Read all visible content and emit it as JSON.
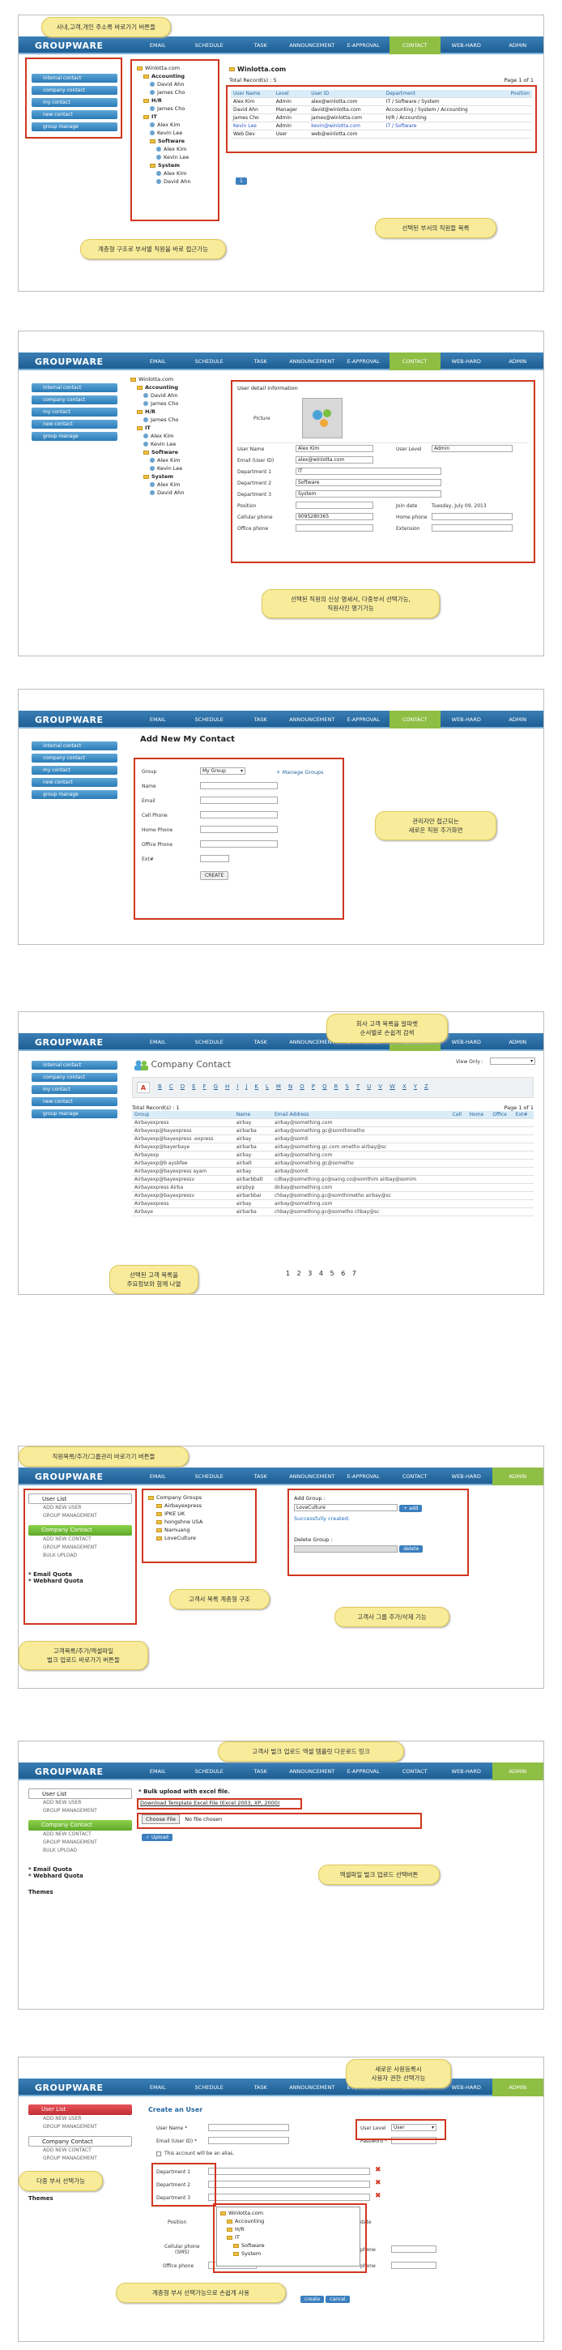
{
  "app": {
    "logo": "GROUPWARE",
    "nav": [
      "EMAIL",
      "SCHEDULE",
      "TASK",
      "ANNOUNCEMENT",
      "E-APPROVAL",
      "CONTACT",
      "WEB-HARD",
      "ADMIN"
    ],
    "nav_short": [
      "EMAIL",
      "SCHEDULE",
      "TASK",
      "ANNOUNCEMENT",
      "E-APPROVAL",
      "CONTACT",
      "WEB-HARD",
      "ADMIN"
    ]
  },
  "side": {
    "internal": "internal contact",
    "company": "company contact",
    "my": "my contact",
    "new": "new contact",
    "group": "group manage"
  },
  "tree": {
    "root": "Winlotta.com",
    "accounting": "Accounting",
    "david": "David Ahn",
    "james": "James Cho",
    "hr": "H/R",
    "it": "IT",
    "alex": "Alex Kim",
    "kevin": "Kevin Lee",
    "software": "Software",
    "system": "System"
  },
  "p1": {
    "note_top": "사내,고객,개인 주소록 바로가기 버튼들",
    "note_tree": "계층형 구조로 부서별 직원을 바로 접근가능",
    "note_list": "선택된 부서의 직원들 목록",
    "title": "Winlotta.com",
    "total": "Total Record(s) : 5",
    "page": "Page 1 of 1",
    "cols": [
      "User Name",
      "Level",
      "User ID",
      "Department",
      "Position"
    ],
    "rows": [
      [
        "Alex Kim",
        "Admin",
        "alex@winlotta.com",
        "IT / Software / System",
        ""
      ],
      [
        "David Ahn",
        "Manager",
        "david@winlotta.com",
        "Accounting / System / Accounting",
        ""
      ],
      [
        "James Cho",
        "Admin",
        "james@winlotta.com",
        "H/R / Accounting",
        ""
      ],
      [
        "Kevin Lee",
        "Admin",
        "kevin@winlotta.com",
        "IT / Software",
        ""
      ],
      [
        "Web Dev",
        "User",
        "web@winlotta.com",
        "",
        ""
      ]
    ],
    "pager": "1"
  },
  "p2": {
    "detail_title": "User detail information",
    "picture": "Picture",
    "user_name_l": "User Name",
    "user_name": "Alex Kim",
    "user_level_l": "User Level",
    "user_level": "Admin",
    "email_l": "Email (User ID)",
    "email": "alex@winlotta.com",
    "d1_l": "Department 1",
    "d1": "IT",
    "d2_l": "Department 2",
    "d2": "Software",
    "d3_l": "Department 3",
    "d3": "System",
    "pos_l": "Position",
    "join_l": "Join date",
    "join": "Tuesday, July 09, 2013",
    "cell_l": "Cellular phone",
    "cell": "9095280365",
    "home_l": "Home phone",
    "office_l": "Office phone",
    "ext_l": "Extension",
    "note": "선택된 직원의 신상 명세서, 다중부서 선택가능,\n직원사진 명기가능"
  },
  "p3": {
    "title": "Add New My Contact",
    "group_l": "Group",
    "group_v": "My Group",
    "manage": "+ Manage Groups",
    "fields": [
      "Name",
      "Email",
      "Cell Phone",
      "Home Phone",
      "Office Phone",
      "Ext#"
    ],
    "create": "CREATE",
    "note": "관리자만 접근되는\n새로운 직원 추가화면"
  },
  "p4": {
    "title": "Company Contact",
    "view_only": "View Only :",
    "letters": [
      "A",
      "B",
      "C",
      "D",
      "E",
      "F",
      "G",
      "H",
      "I",
      "J",
      "K",
      "L",
      "M",
      "N",
      "O",
      "P",
      "Q",
      "R",
      "S",
      "T",
      "U",
      "V",
      "W",
      "X",
      "Y",
      "Z"
    ],
    "total": "Total Record(s) : 1",
    "page": "Page 1 of 1",
    "cols": [
      "Group",
      "Name",
      "Email Address",
      "Cell",
      "Home",
      "Office",
      "Ext#"
    ],
    "rows": [
      [
        "Airbayexpress",
        "airbay",
        "airbay@something.com"
      ],
      [
        "Airbayexp@bayexpress",
        "airbarba",
        "airbay@something.gc@somthimetho"
      ],
      [
        "Airbayexp@bayexpress .express",
        "airbay",
        "airbay@somit"
      ],
      [
        "Airbayexp@bayerbaye",
        "airbarba",
        "airbay@something.gc.com ometho  airbay@sc"
      ],
      [
        "Airbayexp",
        "airbay",
        "airbay@something.com"
      ],
      [
        "Airbayexp@b  aysbfee",
        "airbalt",
        "airbay@something.gc@sometho"
      ],
      [
        "Airbayexp@bayexpress  ayam",
        "airbay",
        "airbay@somit"
      ],
      [
        "Airbayexp@bayexpressv",
        "airbarbbalt",
        "cdbay@something.gc@saing.co@somthim  airbay@somim"
      ],
      [
        "Airbayexpress  Airba",
        "airpbyp",
        "dnbay@something.com"
      ],
      [
        "Airbayexp@bayexpressv",
        "airbarbbai",
        "chbay@something.gc@somthimetho  airbay@sc"
      ],
      [
        "Airbayexpress",
        "airbay",
        "airbay@something.com"
      ],
      [
        "Airbaye",
        "airbarba",
        "chbay@something.gc@sometho  chbay@sc"
      ]
    ],
    "pager": "1 2 3 4 5 6 7",
    "note_top": "회사 고객 목록을 알파벳\n순서별로 손쉽게 검색",
    "note_bottom": "선택된 고객 목록을\n주요정보와 함께 나열"
  },
  "p5": {
    "user_list": "User List",
    "add_user": "ADD NEW USER",
    "group_mgmt": "GROUP MANAGEMENT",
    "company_contact": "Company Contact",
    "add_contact": "ADD NEW CONTACT",
    "group_mgmt2": "GROUP MANAGEMENT",
    "bulk": "BULK UPLOAD",
    "email_quota": "* Email Quota",
    "webhard_quota": "* Webhard Quota",
    "groups_root": "Company Groups",
    "groups": [
      "Airbayexpress",
      "IPKE UK",
      "hongshne USA",
      "Namuang",
      "LoveCulture"
    ],
    "add_group_l": "Add Group :",
    "add_group_v": "LoveCulture",
    "add_btn": "+ add",
    "success": "Successfully created.",
    "delete_group_l": "Delete Group :",
    "delete_btn": "delete",
    "note_top": "직원목록/추가/그룹관리 바로가기 버튼들",
    "note_tree": "고객사 목록 계층형 구조",
    "note_right": "고객사 그룹 추가/삭제 기능",
    "note_left": "고객목록/추가/엑셀파일\n벌크 업로드 바로가기 버튼들"
  },
  "p6": {
    "bulk_title": "* Bulk upload with excel file.",
    "download": "Download Template Excel File (Excel 2003, XP, 2000)",
    "choose": "Choose File",
    "no_file": "No file chosen",
    "upload": "Upload",
    "themes": "Themes",
    "note_top": "고객사 벌크 업로드 엑셀 템플릿 다운로드 링크",
    "note_mid": "엑셀파일 벌크 업로드 선택버튼"
  },
  "p7": {
    "create_title": "Create an User",
    "user_name_l": "User Name *",
    "email_l": "Email (User ID) *",
    "alias": "This account will be an alias.",
    "user_level_l": "User Level",
    "user_level_v": "User",
    "password_l": "Password *",
    "d1": "Department 1",
    "d2": "Department 2",
    "d3": "Department 3",
    "position": "Position",
    "date_l": "date",
    "cell_l": "Cellular phone\n(SMS)",
    "phone_l": "phone",
    "office_l": "Office phone",
    "create_btn": "create",
    "cancel_btn": "cancel",
    "note_top": "새로운 사원등록시\n사용자 권한 선택가능",
    "note_dept": "다중 부서 선택가능",
    "note_tree": "계층형 부서 선택가능으로 손쉽게 사용"
  }
}
